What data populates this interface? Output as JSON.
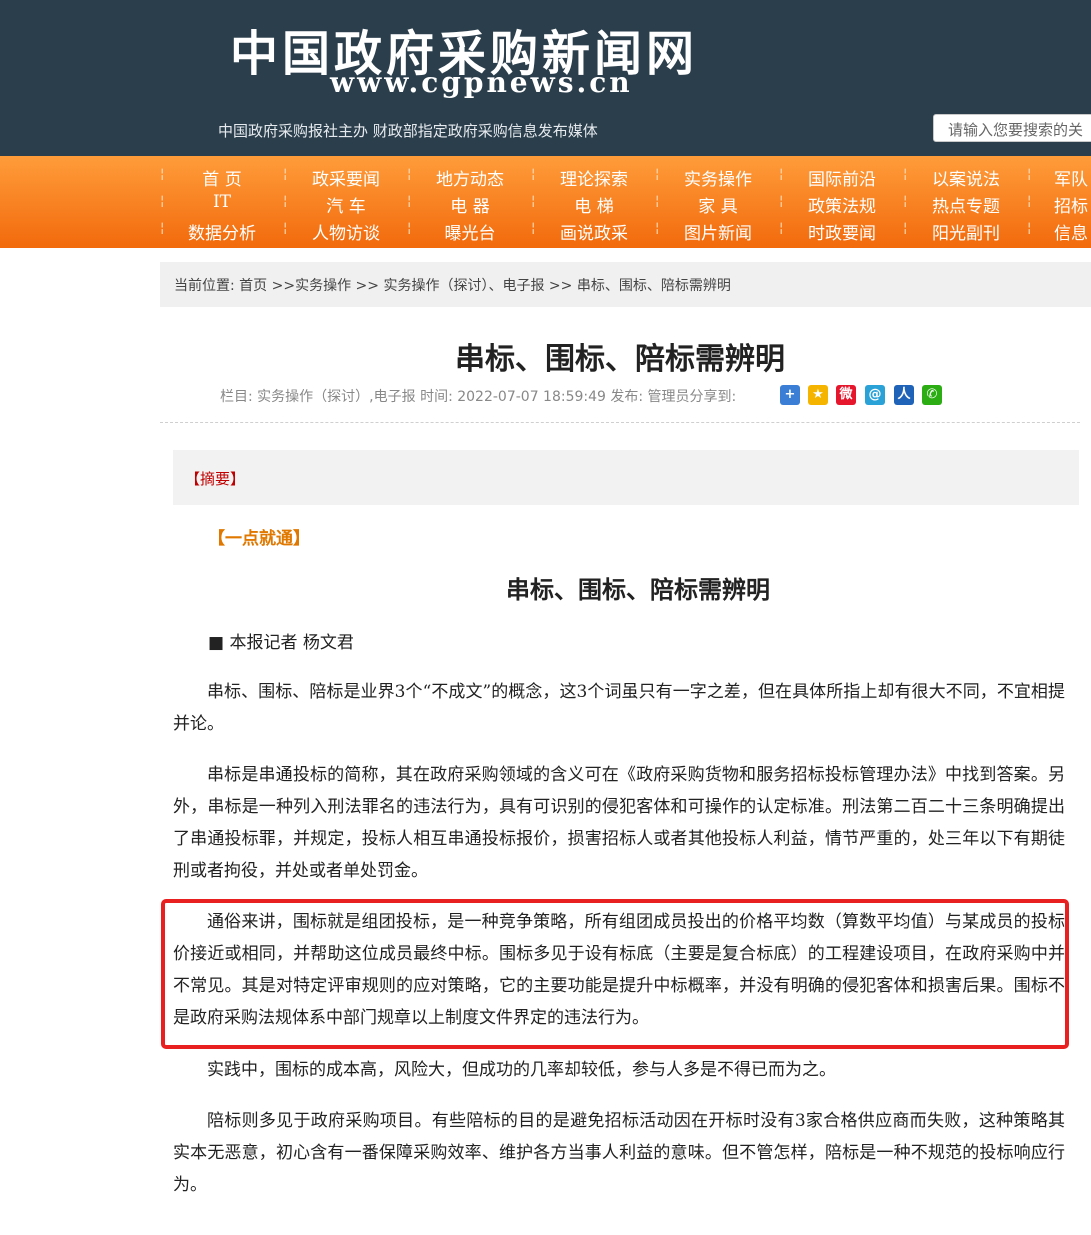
{
  "header": {
    "site_name": "中国政府采购新闻网",
    "site_url": "www.cgpnews.cn",
    "tagline": "中国政府采购报社主办 财政部指定政府采购信息发布媒体",
    "search_placeholder": "请输入您要搜索的关"
  },
  "nav": {
    "rows": [
      [
        "首 页",
        "政采要闻",
        "地方动态",
        "理论探索",
        "实务操作",
        "国际前沿",
        "以案说法",
        "军队"
      ],
      [
        "IT",
        "汽 车",
        "电 器",
        "电 梯",
        "家 具",
        "政策法规",
        "热点专题",
        "招标"
      ],
      [
        "数据分析",
        "人物访谈",
        "曝光台",
        "画说政采",
        "图片新闻",
        "时政要闻",
        "阳光副刊",
        "信息"
      ]
    ]
  },
  "breadcrumb": {
    "prefix": "当前位置:",
    "items": [
      "首页",
      "实务操作",
      "实务操作（探讨）、电子报",
      "串标、围标、陪标需辨明"
    ]
  },
  "article": {
    "title": "串标、围标、陪标需辨明",
    "meta": "栏目: 实务操作（探讨）,电子报 时间: 2022-07-07 18:59:49   发布: 管理员分享到:",
    "abstract_label": "【摘要】",
    "point_label": "【一点就通】",
    "sub_title": "串标、围标、陪标需辨明",
    "author": "■ 本报记者 杨文君",
    "paragraphs": [
      "串标、围标、陪标是业界3个“不成文”的概念，这3个词虽只有一字之差，但在具体所指上却有很大不同，不宜相提并论。",
      "串标是串通投标的简称，其在政府采购领域的含义可在《政府采购货物和服务招标投标管理办法》中找到答案。另外，串标是一种列入刑法罪名的违法行为，具有可识别的侵犯客体和可操作的认定标准。刑法第二百二十三条明确提出了串通投标罪，并规定，投标人相互串通投标报价，损害招标人或者其他投标人利益，情节严重的，处三年以下有期徒刑或者拘役，并处或者单处罚金。",
      "通俗来讲，围标就是组团投标，是一种竞争策略，所有组团成员投出的价格平均数（算数平均值）与某成员的投标价接近或相同，并帮助这位成员最终中标。围标多见于设有标底（主要是复合标底）的工程建设项目，在政府采购中并不常见。其是对特定评审规则的应对策略，它的主要功能是提升中标概率，并没有明确的侵犯客体和损害后果。围标不是政府采购法规体系中部门规章以上制度文件界定的违法行为。",
      "实践中，围标的成本高，风险大，但成功的几率却较低，参与人多是不得已而为之。",
      "陪标则多见于政府采购项目。有些陪标的目的是避免招标活动因在开标时没有3家合格供应商而失败，这种策略其实本无恶意，初心含有一番保障采购效率、维护各方当事人利益的意味。但不管怎样，陪标是一种不规范的投标响应行为。"
    ]
  },
  "share_icons": [
    {
      "name": "plus-icon",
      "glyph": "+",
      "color": "#3a7fd5"
    },
    {
      "name": "qzone-icon",
      "glyph": "★",
      "color": "#f5b400"
    },
    {
      "name": "weibo-icon",
      "glyph": "微",
      "color": "#e6162d"
    },
    {
      "name": "tencent-weibo-icon",
      "glyph": "@",
      "color": "#2aa2d8"
    },
    {
      "name": "renren-icon",
      "glyph": "人",
      "color": "#1f63b9"
    },
    {
      "name": "wechat-icon",
      "glyph": "✆",
      "color": "#2bad13"
    }
  ],
  "colors": {
    "header_bg": "#2b3e4c",
    "nav_accent": "#f26a0c",
    "highlight_border": "#e82020",
    "abstract_label": "#c00000",
    "point_label": "#e07800"
  }
}
